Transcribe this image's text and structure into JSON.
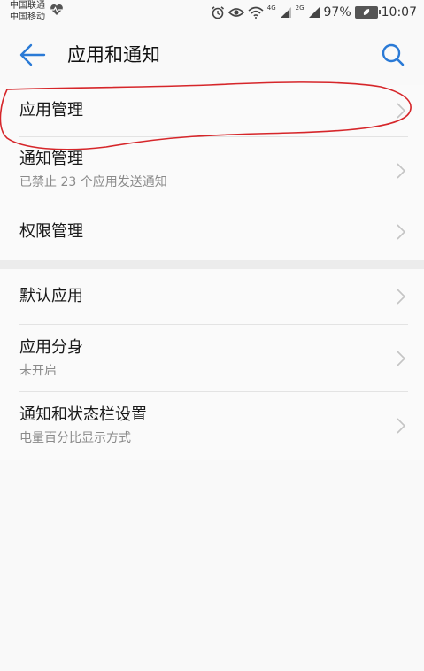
{
  "status_bar": {
    "carrier_1": "中国联通",
    "carrier_2": "中国移动",
    "net_1": "4G",
    "net_2": "2G",
    "battery": "97%",
    "time": "10:07"
  },
  "title_bar": {
    "title": "应用和通知"
  },
  "groups": [
    {
      "items": [
        {
          "label": "应用管理",
          "sub": ""
        },
        {
          "label": "通知管理",
          "sub": "已禁止 23 个应用发送通知"
        },
        {
          "label": "权限管理",
          "sub": ""
        }
      ]
    },
    {
      "items": [
        {
          "label": "默认应用",
          "sub": ""
        },
        {
          "label": "应用分身",
          "sub": "未开启"
        },
        {
          "label": "通知和状态栏设置",
          "sub": "电量百分比显示方式"
        }
      ]
    }
  ],
  "colors": {
    "accent": "#2a7ad6",
    "annotation": "#d6262a"
  }
}
